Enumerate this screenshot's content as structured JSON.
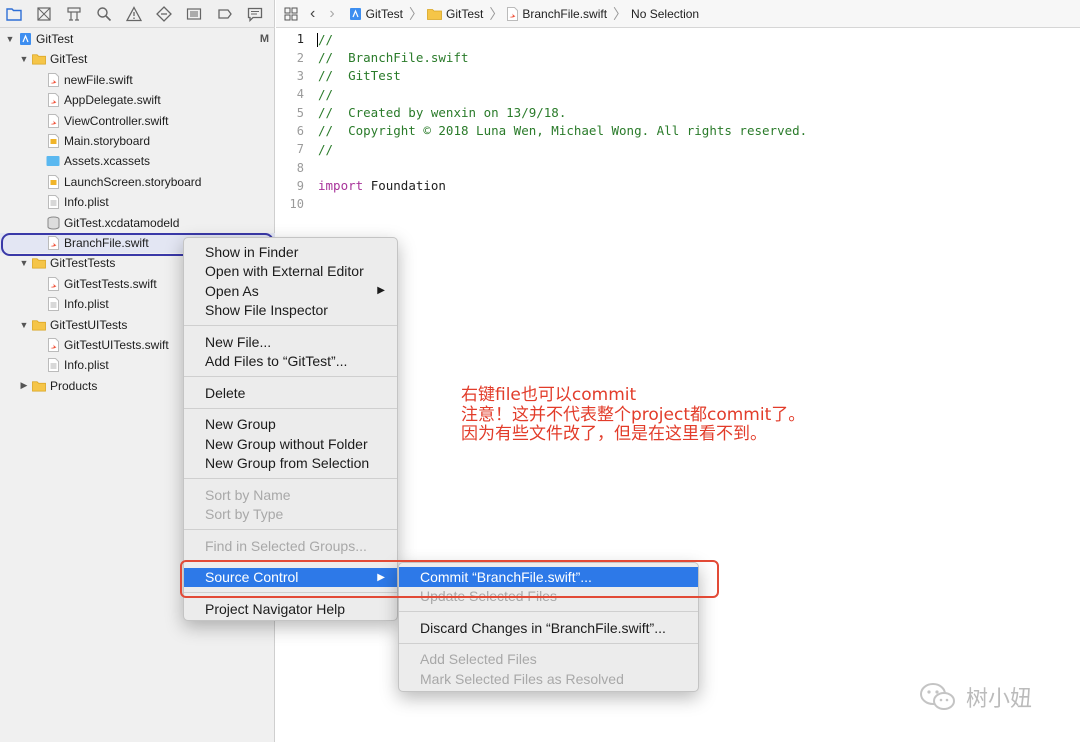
{
  "navigator": {
    "toolbar_icons": [
      "folder-icon",
      "source-control-icon",
      "hierarchy-icon",
      "search-icon",
      "warning-icon",
      "test-icon",
      "debug-icon",
      "breakpoint-icon",
      "report-icon"
    ],
    "tree": [
      {
        "label": "GitTest",
        "type": "project",
        "badge": "M",
        "depth": 0,
        "disclosure": "open"
      },
      {
        "label": "GitTest",
        "type": "folder",
        "depth": 1,
        "disclosure": "open"
      },
      {
        "label": "newFile.swift",
        "type": "swift",
        "depth": 2
      },
      {
        "label": "AppDelegate.swift",
        "type": "swift",
        "depth": 2
      },
      {
        "label": "ViewController.swift",
        "type": "swift",
        "depth": 2
      },
      {
        "label": "Main.storyboard",
        "type": "storyboard",
        "depth": 2
      },
      {
        "label": "Assets.xcassets",
        "type": "assets",
        "depth": 2
      },
      {
        "label": "LaunchScreen.storyboard",
        "type": "storyboard",
        "depth": 2
      },
      {
        "label": "Info.plist",
        "type": "plist",
        "depth": 2
      },
      {
        "label": "GitTest.xcdatamodeld",
        "type": "datamodel",
        "depth": 2
      },
      {
        "label": "BranchFile.swift",
        "type": "swift",
        "depth": 2,
        "selected": true
      },
      {
        "label": "GitTestTests",
        "type": "folder",
        "depth": 1,
        "disclosure": "open"
      },
      {
        "label": "GitTestTests.swift",
        "type": "swift",
        "depth": 2
      },
      {
        "label": "Info.plist",
        "type": "plist",
        "depth": 2
      },
      {
        "label": "GitTestUITests",
        "type": "folder",
        "depth": 1,
        "disclosure": "open"
      },
      {
        "label": "GitTestUITests.swift",
        "type": "swift",
        "depth": 2
      },
      {
        "label": "Info.plist",
        "type": "plist",
        "depth": 2
      },
      {
        "label": "Products",
        "type": "folder",
        "depth": 1,
        "disclosure": "closed"
      }
    ]
  },
  "jumpbar": {
    "items": [
      "GitTest",
      "GitTest",
      "BranchFile.swift",
      "No Selection"
    ]
  },
  "editor": {
    "lines": [
      {
        "n": "1",
        "text": "//",
        "kind": "comment"
      },
      {
        "n": "2",
        "text": "//  BranchFile.swift",
        "kind": "comment"
      },
      {
        "n": "3",
        "text": "//  GitTest",
        "kind": "comment"
      },
      {
        "n": "4",
        "text": "//",
        "kind": "comment"
      },
      {
        "n": "5",
        "text": "//  Created by wenxin on 13/9/18.",
        "kind": "comment"
      },
      {
        "n": "6",
        "text": "//  Copyright © 2018 Luna Wen, Michael Wong. All rights reserved.",
        "kind": "comment"
      },
      {
        "n": "7",
        "text": "//",
        "kind": "comment"
      },
      {
        "n": "8",
        "text": "",
        "kind": "plain"
      },
      {
        "n": "9",
        "text": "Foundation",
        "kind": "import",
        "keyword": "import"
      },
      {
        "n": "10",
        "text": "",
        "kind": "plain"
      }
    ]
  },
  "context_menu": {
    "items": [
      {
        "label": "Show in Finder"
      },
      {
        "label": "Open with External Editor"
      },
      {
        "label": "Open As",
        "submenu": true
      },
      {
        "label": "Show File Inspector"
      },
      {
        "sep": true
      },
      {
        "label": "New File..."
      },
      {
        "label": "Add Files to “GitTest”..."
      },
      {
        "sep": true
      },
      {
        "label": "Delete"
      },
      {
        "sep": true
      },
      {
        "label": "New Group"
      },
      {
        "label": "New Group without Folder"
      },
      {
        "label": "New Group from Selection"
      },
      {
        "sep": true
      },
      {
        "label": "Sort by Name",
        "disabled": true
      },
      {
        "label": "Sort by Type",
        "disabled": true
      },
      {
        "sep": true
      },
      {
        "label": "Find in Selected Groups...",
        "disabled": true
      },
      {
        "sep": true
      },
      {
        "label": "Source Control",
        "submenu": true,
        "highlighted": true
      },
      {
        "sep": true
      },
      {
        "label": "Project Navigator Help"
      }
    ]
  },
  "submenu": {
    "items": [
      {
        "label": "Commit “BranchFile.swift”...",
        "highlighted": true
      },
      {
        "label": "Update Selected Files",
        "disabled": true
      },
      {
        "sep": true
      },
      {
        "label": "Discard Changes in “BranchFile.swift”..."
      },
      {
        "sep": true
      },
      {
        "label": "Add Selected Files",
        "disabled": true
      },
      {
        "label": "Mark Selected Files as Resolved",
        "disabled": true
      }
    ]
  },
  "annotation": {
    "lines": [
      "右键file也可以commit",
      "注意！这并不代表整个project都commit了。",
      "因为有些文件改了，但是在这里看不到。"
    ]
  },
  "watermark": {
    "text": "树小妞"
  },
  "colors": {
    "accent": "#2d79e8",
    "annotation": "#e23c2a",
    "selection_ring": "#3a39a8"
  }
}
